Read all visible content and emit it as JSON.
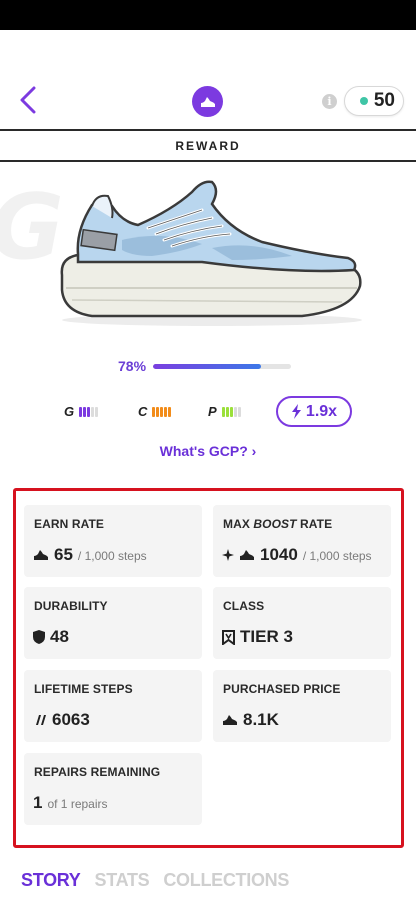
{
  "header": {
    "back_icon": "chevron-left-icon",
    "brand_icon": "shoe-icon",
    "info_icon": "i",
    "coins": "50"
  },
  "reward_bar": {
    "label": "REWARD"
  },
  "sneaker": {
    "watermark": "G",
    "image": "sneaker-illustration"
  },
  "progress": {
    "label": "78%",
    "value": 0.78
  },
  "gcp": {
    "items": [
      {
        "letter": "G",
        "color": "#7c3ae0",
        "filled": 3,
        "total": 5
      },
      {
        "letter": "C",
        "color": "#f28c1a",
        "filled": 5,
        "total": 5
      },
      {
        "letter": "P",
        "color": "#9be03a",
        "filled": 3,
        "total": 5
      }
    ],
    "boost": "1.9x"
  },
  "gcp_link": "What's GCP? ›",
  "stats": {
    "earn_rate": {
      "label": "EARN RATE",
      "value": "65",
      "unit": "/ 1,000 steps"
    },
    "max_boost_rate": {
      "label_prefix": "MAX ",
      "label_italic": "BOOST",
      "label_suffix": " RATE",
      "value": "1040",
      "unit": "/ 1,000 steps"
    },
    "durability": {
      "label": "DURABILITY",
      "value": "48"
    },
    "class": {
      "label": "CLASS",
      "value": "TIER 3"
    },
    "lifetime_steps": {
      "label": "LIFETIME STEPS",
      "value": "6063"
    },
    "purchased_price": {
      "label": "PURCHASED PRICE",
      "value": "8.1K"
    },
    "repairs_remaining": {
      "label": "REPAIRS REMAINING",
      "value": "1",
      "unit": "of 1 repairs"
    }
  },
  "tabs": [
    "STORY",
    "STATS",
    "COLLECTIONS"
  ],
  "colors": {
    "accent": "#6a30d8",
    "frame": "#d6121f"
  }
}
